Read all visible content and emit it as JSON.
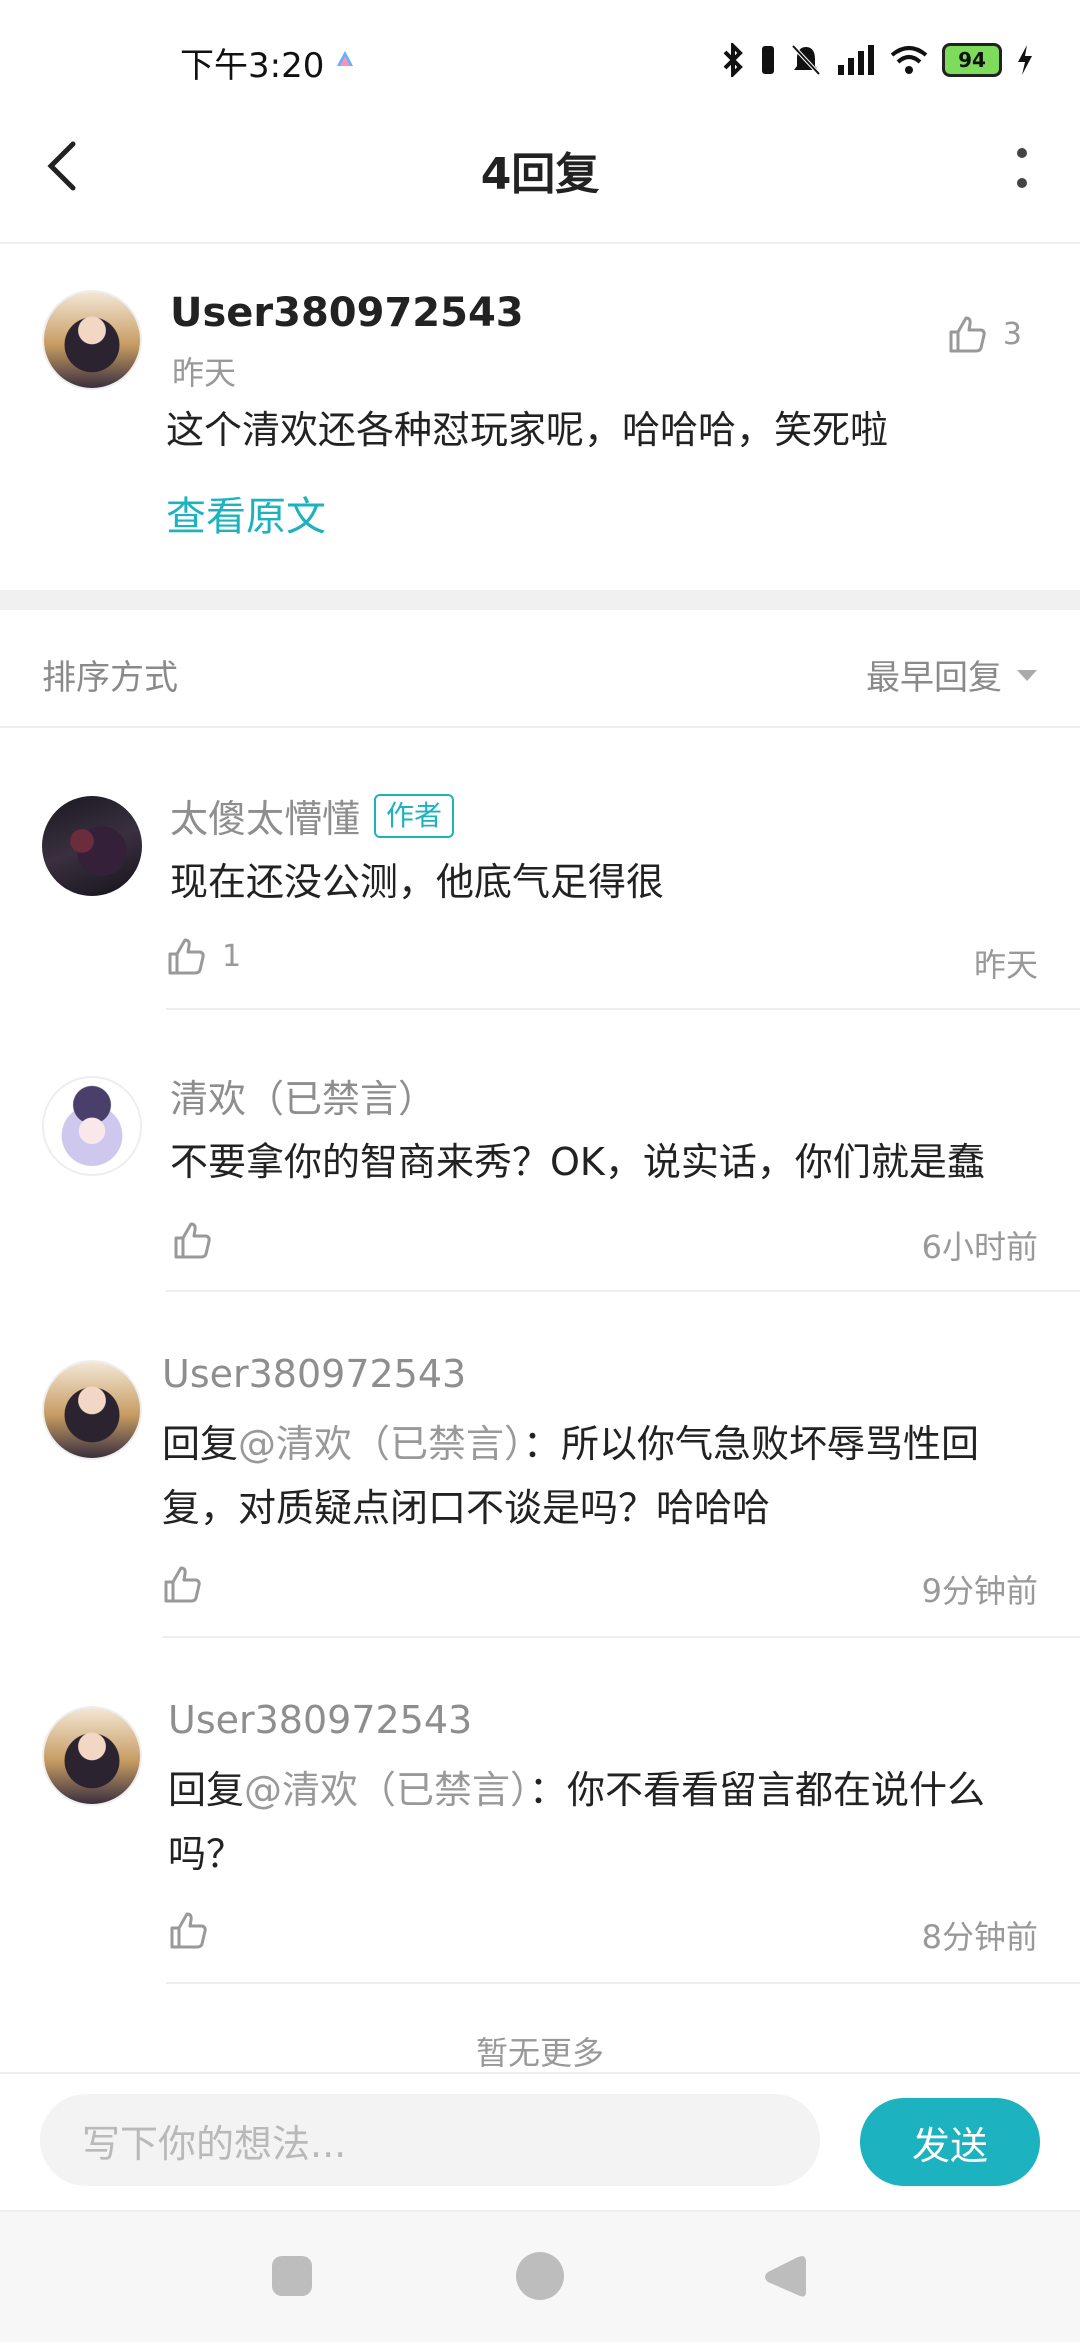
{
  "status_bar": {
    "time": "下午3:20",
    "battery": "94"
  },
  "header": {
    "title": "4回复"
  },
  "original_comment": {
    "username": "User380972543",
    "time": "昨天",
    "likes": "3",
    "text": "这个清欢还各种怼玩家呢，哈哈哈，笑死啦",
    "view_original": "查看原文"
  },
  "sort": {
    "label": "排序方式",
    "selected": "最早回复"
  },
  "replies": [
    {
      "username": "太傻太懵懂",
      "badge": "作者",
      "text": "现在还没公测，他底气足得很",
      "likes": "1",
      "time": "昨天"
    },
    {
      "username": "清欢（已禁言）",
      "text": "不要拿你的智商来秀？OK，说实话，你们就是蠢",
      "time": "6小时前"
    },
    {
      "username": "User380972543",
      "prefix": "回复",
      "mention": "@清欢（已禁言）",
      "text": "：所以你气急败坏辱骂性回复，对质疑点闭口不谈是吗？哈哈哈",
      "time": "9分钟前"
    },
    {
      "username": "User380972543",
      "prefix": "回复",
      "mention": "@清欢（已禁言）",
      "text": "：你不看看留言都在说什么吗？",
      "time": "8分钟前"
    }
  ],
  "footer": {
    "no_more": "暂无更多"
  },
  "composer": {
    "placeholder": "写下你的想法...",
    "send_label": "发送"
  },
  "colors": {
    "accent": "#1cb2bf"
  }
}
